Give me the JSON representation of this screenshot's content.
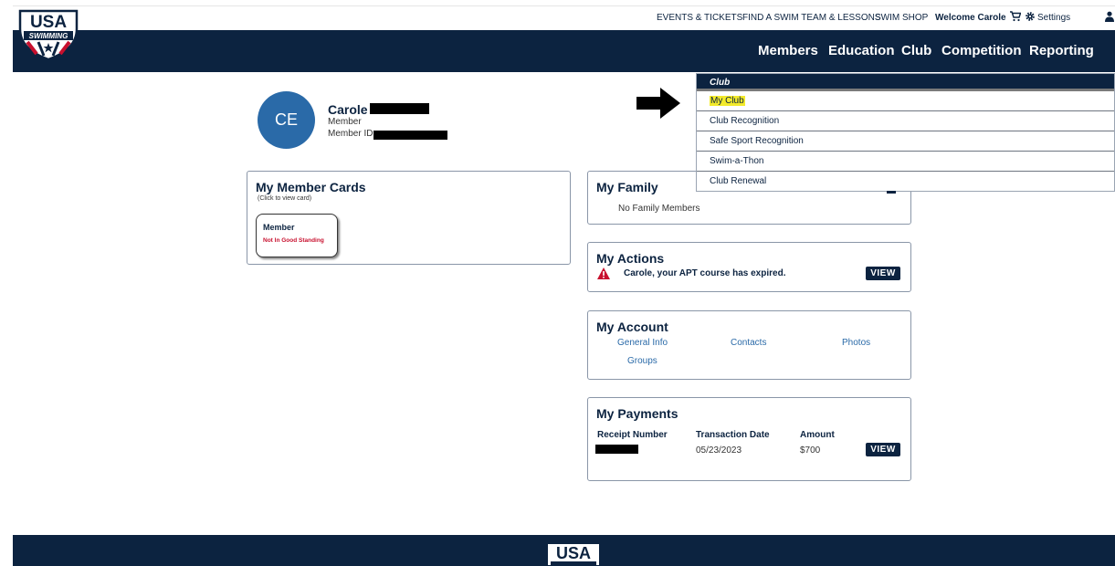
{
  "topbar": {
    "events_tickets": "EVENTS & TICKETS",
    "find_team": "FIND A SWIM TEAM & LESSONS",
    "swim_shop": "SWIM SHOP",
    "welcome": "Welcome Carole",
    "settings": "Settings"
  },
  "logo": {
    "usa": "USA",
    "swimming": "SWIMMING"
  },
  "nav": {
    "members": "Members",
    "education": "Education",
    "club": "Club",
    "competition": "Competition",
    "reporting": "Reporting"
  },
  "dropdown": {
    "header": "Club",
    "items": [
      "My Club",
      "Club Recognition",
      "Safe Sport Recognition",
      "Swim-a-Thon",
      "Club Renewal"
    ],
    "highlighted_index": 0,
    "highlight_color": "#f3ea2b"
  },
  "profile": {
    "initials": "CE",
    "name": "Carole",
    "role": "Member",
    "member_id_label": "Member ID:"
  },
  "member_cards": {
    "title": "My Member Cards",
    "hint": "(Click to view card)",
    "card_type": "Member",
    "card_status": "Not In Good Standing"
  },
  "family": {
    "title": "My Family",
    "empty_text": "No Family Members"
  },
  "actions": {
    "title": "My Actions",
    "message": "Carole, your APT course has expired.",
    "view_label": "VIEW"
  },
  "account": {
    "title": "My Account",
    "links": [
      "General Info",
      "Contacts",
      "Photos",
      "Groups"
    ]
  },
  "payments": {
    "title": "My Payments",
    "columns": [
      "Receipt Number",
      "Transaction Date",
      "Amount"
    ],
    "rows": [
      {
        "date": "05/23/2023",
        "amount": "$700",
        "view_label": "VIEW"
      }
    ]
  },
  "colors": {
    "navy": "#0c2340",
    "avatar_blue": "#2a6aa8",
    "alert_red": "#c8102e",
    "status_red": "#c8102e"
  }
}
